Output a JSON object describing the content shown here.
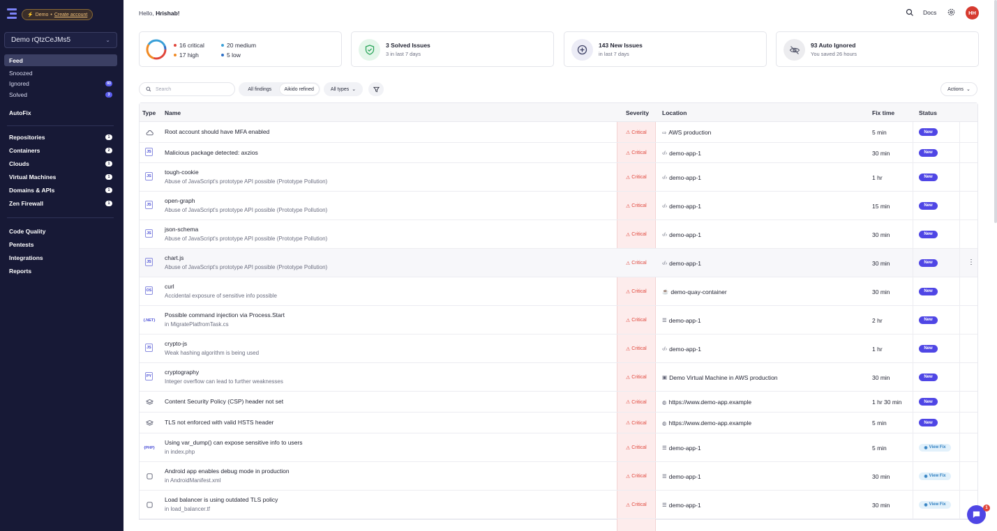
{
  "sidebar": {
    "demo_label": "Demo",
    "demo_dot": "•",
    "create_account": "Create account",
    "org": "Demo rQtzCeJMs5",
    "primary": [
      {
        "label": "Feed",
        "badge": ""
      },
      {
        "label": "Snoozed",
        "badge": ""
      },
      {
        "label": "Ignored",
        "badge": "93"
      },
      {
        "label": "Solved",
        "badge": "3"
      }
    ],
    "autofix": "AutoFix",
    "resources": [
      {
        "label": "Repositories",
        "badge": "1"
      },
      {
        "label": "Containers",
        "badge": "2"
      },
      {
        "label": "Clouds",
        "badge": "1"
      },
      {
        "label": "Virtual Machines",
        "badge": "1"
      },
      {
        "label": "Domains & APIs",
        "badge": "1"
      },
      {
        "label": "Zen Firewall",
        "badge": "1"
      }
    ],
    "tools": [
      {
        "label": "Code Quality"
      },
      {
        "label": "Pentests"
      },
      {
        "label": "Integrations"
      },
      {
        "label": "Reports"
      }
    ]
  },
  "topbar": {
    "greeting_prefix": "Hello,",
    "user_name": "Hrishab!",
    "docs": "Docs",
    "avatar_initials": "HH"
  },
  "stats": {
    "critical": "16 critical",
    "high": "17 high",
    "medium": "20 medium",
    "low": "5 low",
    "solved_title": "3 Solved Issues",
    "solved_sub": "3 in last 7 days",
    "new_title": "143 New Issues",
    "new_sub": "in last 7 days",
    "ignored_title": "93 Auto Ignored",
    "ignored_sub": "You saved 26 hours"
  },
  "filters": {
    "search_placeholder": "Search",
    "all_findings": "All findings",
    "aikido_refined": "Aikido refined",
    "all_types": "All types",
    "actions": "Actions"
  },
  "table": {
    "headers": {
      "type": "Type",
      "name": "Name",
      "severity": "Severity",
      "location": "Location",
      "fix_time": "Fix time",
      "status": "Status"
    },
    "rows": [
      {
        "type_icon": "cloud-icon",
        "type_label": "",
        "name": "Root account should have MFA enabled",
        "desc": "",
        "severity": "Critical",
        "loc_icon": "⇨",
        "location": "AWS production",
        "fix": "5 min",
        "status": "New"
      },
      {
        "type_icon": "js-package-icon",
        "type_label": "JS",
        "name": "Malicious package detected: axzios",
        "desc": "",
        "severity": "Critical",
        "loc_icon": "‹/›",
        "location": "demo-app-1",
        "fix": "30 min",
        "status": "New"
      },
      {
        "type_icon": "js-package-icon",
        "type_label": "JS",
        "name": "tough-cookie",
        "desc": "Abuse of JavaScript's prototype API possible (Prototype Pollution)",
        "severity": "Critical",
        "loc_icon": "‹/›",
        "location": "demo-app-1",
        "fix": "1 hr",
        "status": "New"
      },
      {
        "type_icon": "js-package-icon",
        "type_label": "JS",
        "name": "open-graph",
        "desc": "Abuse of JavaScript's prototype API possible (Prototype Pollution)",
        "severity": "Critical",
        "loc_icon": "‹/›",
        "location": "demo-app-1",
        "fix": "15 min",
        "status": "New"
      },
      {
        "type_icon": "js-package-icon",
        "type_label": "JS",
        "name": "json-schema",
        "desc": "Abuse of JavaScript's prototype API possible (Prototype Pollution)",
        "severity": "Critical",
        "loc_icon": "‹/›",
        "location": "demo-app-1",
        "fix": "30 min",
        "status": "New"
      },
      {
        "type_icon": "js-package-icon",
        "type_label": "JS",
        "name": "chart.js",
        "desc": "Abuse of JavaScript's prototype API possible (Prototype Pollution)",
        "severity": "Critical",
        "loc_icon": "‹/›",
        "location": "demo-app-1",
        "fix": "30 min",
        "status": "New"
      },
      {
        "type_icon": "os-package-icon",
        "type_label": "OS",
        "name": "curl",
        "desc": "Accidental exposure of sensitive info possible",
        "severity": "Critical",
        "loc_icon": "☕",
        "location": "demo-quay-container",
        "fix": "30 min",
        "status": "New"
      },
      {
        "type_icon": "dotnet-icon",
        "type_label": "{.NET}",
        "name": "Possible command injection via Process.Start",
        "desc": "in MigratePlatfromTask.cs",
        "severity": "Critical",
        "loc_icon": "☰",
        "location": "demo-app-1",
        "fix": "2 hr",
        "status": "New"
      },
      {
        "type_icon": "js-package-icon",
        "type_label": "JS",
        "name": "crypto-js",
        "desc": "Weak hashing algorithm is being used",
        "severity": "Critical",
        "loc_icon": "‹/›",
        "location": "demo-app-1",
        "fix": "1 hr",
        "status": "New"
      },
      {
        "type_icon": "py-package-icon",
        "type_label": "PY",
        "name": "cryptography",
        "desc": "Integer overflow can lead to further weaknesses",
        "severity": "Critical",
        "loc_icon": "▣",
        "location": "Demo Virtual Machine in AWS production",
        "fix": "30 min",
        "status": "New"
      },
      {
        "type_icon": "layers-icon",
        "type_label": "",
        "name": "Content Security Policy (CSP) header not set",
        "desc": "",
        "severity": "Critical",
        "loc_icon": "◍",
        "location": "https://www.demo-app.example",
        "fix": "1 hr 30 min",
        "status": "New"
      },
      {
        "type_icon": "layers-icon",
        "type_label": "",
        "name": "TLS not enforced with valid HSTS header",
        "desc": "",
        "severity": "Critical",
        "loc_icon": "◍",
        "location": "https://www.demo-app.example",
        "fix": "5 min",
        "status": "New"
      },
      {
        "type_icon": "php-icon",
        "type_label": "{PHP}",
        "name": "Using var_dump() can expose sensitive info to users",
        "desc": "in index.php",
        "severity": "Critical",
        "loc_icon": "☰",
        "location": "demo-app-1",
        "fix": "5 min",
        "status": "View Fix"
      },
      {
        "type_icon": "android-icon",
        "type_label": "",
        "name": "Android app enables debug mode in production",
        "desc": "in AndroidManifest.xml",
        "severity": "Critical",
        "loc_icon": "☰",
        "location": "demo-app-1",
        "fix": "30 min",
        "status": "View Fix"
      },
      {
        "type_icon": "iac-file-icon",
        "type_label": "",
        "name": "Load balancer is using outdated TLS policy",
        "desc": "in load_balancer.tf",
        "severity": "Critical",
        "loc_icon": "☰",
        "location": "demo-app-1",
        "fix": "30 min",
        "status": "View Fix"
      }
    ]
  },
  "chat_badge": "1",
  "colors": {
    "sidebar": "#171936",
    "accent": "#4f46e5",
    "critical": "#e0453a"
  }
}
